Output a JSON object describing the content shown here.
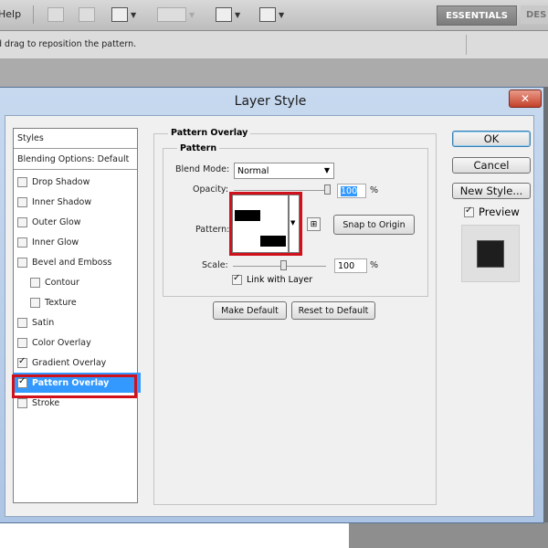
{
  "app": {
    "menu_help": "Help",
    "workspace_button": "ESSENTIALS",
    "workspace_next": "DES",
    "hint": "d drag to reposition the pattern."
  },
  "dialog": {
    "title": "Layer Style",
    "close_glyph": "✕",
    "styles_header": "Styles",
    "blending_options": "Blending Options: Default",
    "items": [
      {
        "label": "Drop Shadow",
        "checked": false,
        "indent": false
      },
      {
        "label": "Inner Shadow",
        "checked": false,
        "indent": false
      },
      {
        "label": "Outer Glow",
        "checked": false,
        "indent": false
      },
      {
        "label": "Inner Glow",
        "checked": false,
        "indent": false
      },
      {
        "label": "Bevel and Emboss",
        "checked": false,
        "indent": false
      },
      {
        "label": "Contour",
        "checked": false,
        "indent": true
      },
      {
        "label": "Texture",
        "checked": false,
        "indent": true
      },
      {
        "label": "Satin",
        "checked": false,
        "indent": false
      },
      {
        "label": "Color Overlay",
        "checked": false,
        "indent": false
      },
      {
        "label": "Gradient Overlay",
        "checked": true,
        "indent": false
      },
      {
        "label": "Pattern Overlay",
        "checked": true,
        "indent": false,
        "selected": true
      },
      {
        "label": "Stroke",
        "checked": false,
        "indent": false
      }
    ],
    "panel": {
      "section_title": "Pattern Overlay",
      "group_title": "Pattern",
      "blend_mode_label": "Blend Mode:",
      "blend_mode_value": "Normal",
      "opacity_label": "Opacity:",
      "opacity_value": "100",
      "opacity_percent": 100,
      "pattern_label": "Pattern:",
      "snap_button": "Snap to Origin",
      "scale_label": "Scale:",
      "scale_value": "100",
      "scale_percent": 100,
      "percent_sign": "%",
      "link_label": "Link with Layer",
      "link_checked": true,
      "make_default": "Make Default",
      "reset_default": "Reset to Default"
    },
    "buttons": {
      "ok": "OK",
      "cancel": "Cancel",
      "new_style": "New Style...",
      "preview_label": "Preview",
      "preview_checked": true
    }
  },
  "colors": {
    "selection": "#3399ff",
    "highlight_outline": "#d0111b"
  }
}
